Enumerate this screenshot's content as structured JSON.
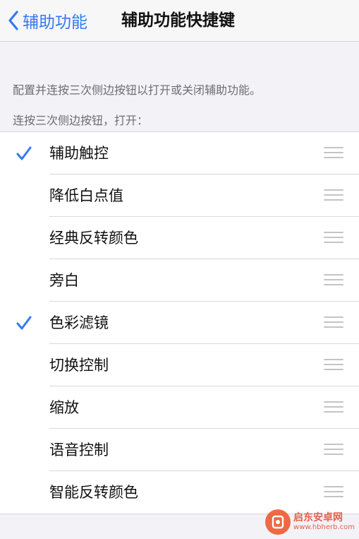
{
  "nav": {
    "back_label": "辅助功能",
    "title": "辅助功能快捷键"
  },
  "footer_text": "配置并连按三次侧边按钮以打开或关闭辅助功能。",
  "section_header": "连按三次侧边按钮，打开：",
  "items": [
    {
      "label": "辅助触控",
      "checked": true
    },
    {
      "label": "降低白点值",
      "checked": false
    },
    {
      "label": "经典反转颜色",
      "checked": false
    },
    {
      "label": "旁白",
      "checked": false
    },
    {
      "label": "色彩滤镜",
      "checked": true
    },
    {
      "label": "切换控制",
      "checked": false
    },
    {
      "label": "缩放",
      "checked": false
    },
    {
      "label": "语音控制",
      "checked": false
    },
    {
      "label": "智能反转颜色",
      "checked": false
    }
  ],
  "watermark": {
    "cn": "启东安卓网",
    "en": "www.hbherb.com"
  },
  "colors": {
    "accent": "#3478f6",
    "background": "#f2f2f7"
  },
  "icons": {
    "back": "chevron-left-icon",
    "check": "checkmark-icon",
    "reorder": "reorder-handle-icon"
  }
}
